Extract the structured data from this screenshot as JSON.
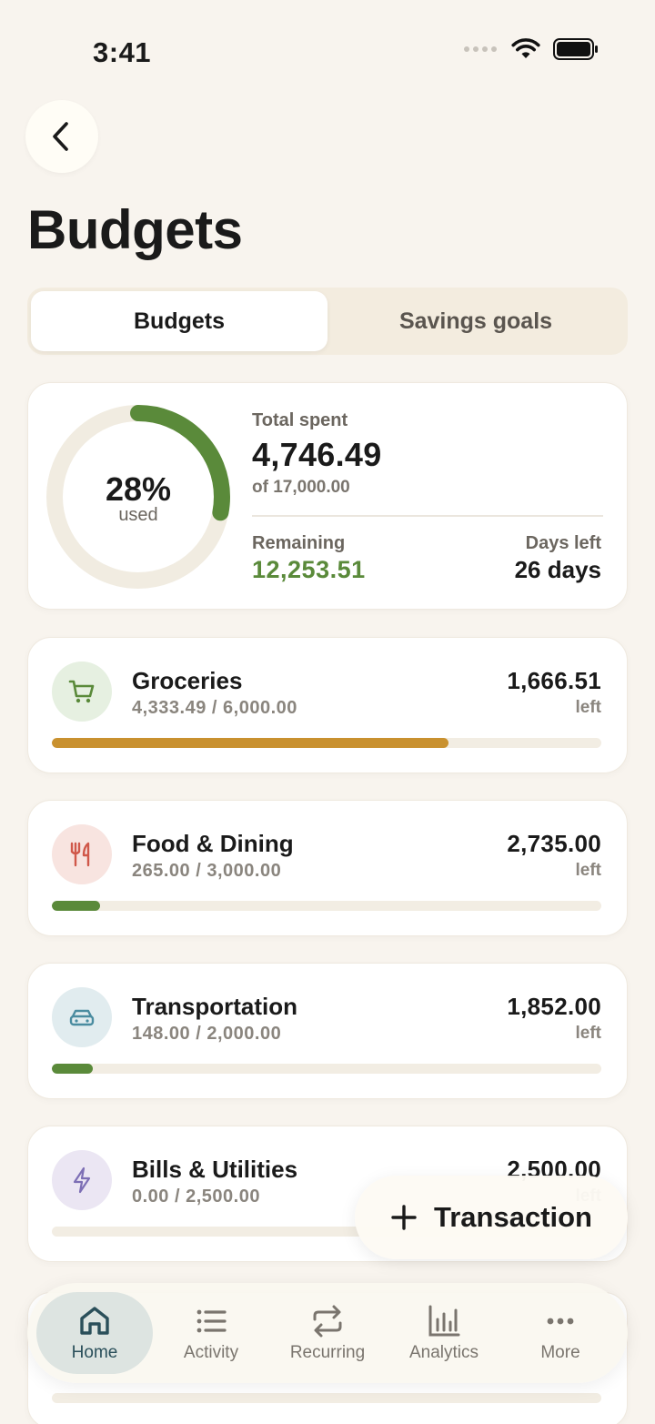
{
  "status": {
    "time": "3:41"
  },
  "page": {
    "title": "Budgets"
  },
  "segments": [
    {
      "label": "Budgets",
      "active": true
    },
    {
      "label": "Savings goals",
      "active": false
    }
  ],
  "summary": {
    "percent_used": 28,
    "percent_label": "28%",
    "used_label": "used",
    "total_label": "Total spent",
    "total_amount": "4,746.49",
    "of_label": "of 17,000.00",
    "remaining_label": "Remaining",
    "remaining_amount": "12,253.51",
    "days_label": "Days left",
    "days_value": "26 days",
    "ring_color": "#5a8a3a",
    "ring_track_color": "#f1ece1"
  },
  "budgets": [
    {
      "name": "Groceries",
      "spent": "4,333.49 / 6,000.00",
      "left_amount": "1,666.51",
      "left_label": "left",
      "progress": 0.722,
      "bar_color": "#c9912f",
      "icon": "cart-icon",
      "icon_bg": "#e6f0e1",
      "icon_color": "#5a8a3a"
    },
    {
      "name": "Food & Dining",
      "spent": "265.00 / 3,000.00",
      "left_amount": "2,735.00",
      "left_label": "left",
      "progress": 0.088,
      "bar_color": "#5a8a3a",
      "icon": "utensils-icon",
      "icon_bg": "#f8e4e0",
      "icon_color": "#d0584a"
    },
    {
      "name": "Transportation",
      "spent": "148.00 / 2,000.00",
      "left_amount": "1,852.00",
      "left_label": "left",
      "progress": 0.074,
      "bar_color": "#5a8a3a",
      "icon": "car-icon",
      "icon_bg": "#e1ecef",
      "icon_color": "#4a8ca0"
    },
    {
      "name": "Bills & Utilities",
      "spent": "0.00 / 2,500.00",
      "left_amount": "2,500.00",
      "left_label": "left",
      "progress": 0,
      "bar_color": "#5a8a3a",
      "icon": "bolt-icon",
      "icon_bg": "#ebe6f3",
      "icon_color": "#7d6fb5"
    }
  ],
  "fab": {
    "label": "Transaction"
  },
  "tabbar": [
    {
      "label": "Home",
      "icon": "home-icon",
      "active": true
    },
    {
      "label": "Activity",
      "icon": "list-icon",
      "active": false
    },
    {
      "label": "Recurring",
      "icon": "repeat-icon",
      "active": false
    },
    {
      "label": "Analytics",
      "icon": "bar-chart-icon",
      "active": false
    },
    {
      "label": "More",
      "icon": "more-icon",
      "active": false
    }
  ]
}
